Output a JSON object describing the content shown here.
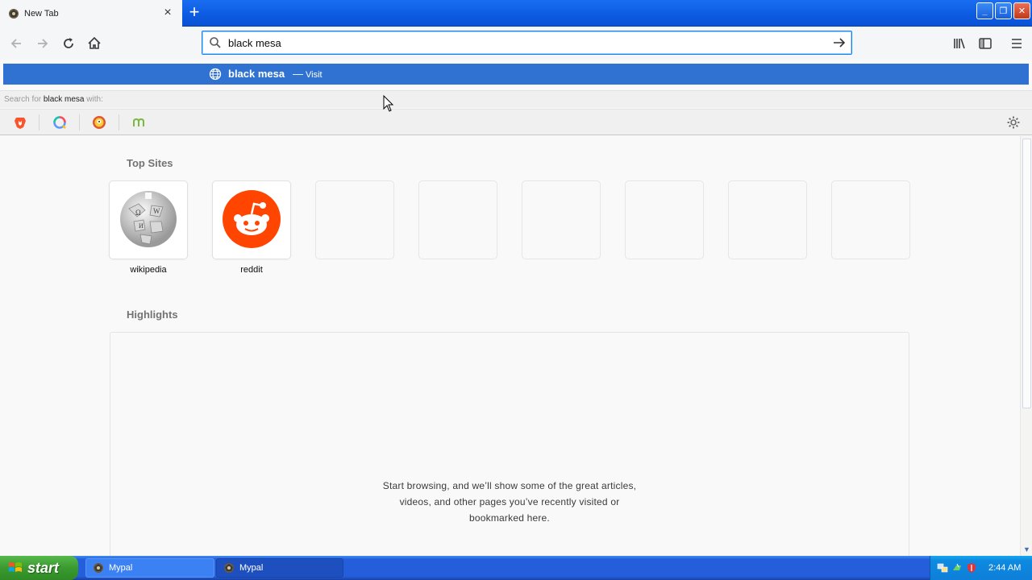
{
  "tab": {
    "title": "New Tab",
    "close_symbol": "×"
  },
  "new_tab_symbol": "+",
  "window_buttons": {
    "minimize": "_",
    "restore": "❐",
    "close": "✕"
  },
  "urlbar": {
    "value": "black mesa",
    "placeholder": ""
  },
  "popup": {
    "result_title": "black mesa",
    "result_dash": "—",
    "result_action": "Visit",
    "search_for_prefix": "Search for",
    "search_for_query": "black mesa",
    "search_for_suffix": "with:",
    "engines": [
      "brave-icon",
      "qwant-icon",
      "duckduckgo-icon",
      "mojeek-icon"
    ]
  },
  "top_sites": {
    "heading": "Top Sites",
    "tiles": [
      {
        "label": "wikipedia",
        "icon": "wikipedia-icon"
      },
      {
        "label": "reddit",
        "icon": "reddit-icon"
      }
    ]
  },
  "highlights": {
    "heading": "Highlights",
    "empty_line1": "Start browsing, and we’ll show some of the great articles,",
    "empty_line2": "videos, and other pages you’ve recently visited or",
    "empty_line3": "bookmarked here."
  },
  "taskbar": {
    "start_label": "start",
    "buttons": [
      {
        "label": "Mypal"
      },
      {
        "label": "Mypal"
      }
    ],
    "clock": "2:44 AM"
  },
  "colors": {
    "accent": "#0a84ff",
    "result_highlight": "#2f72d2",
    "reddit": "#ff4500",
    "xp_blue": "#245edb",
    "xp_green": "#3a9a2f"
  }
}
